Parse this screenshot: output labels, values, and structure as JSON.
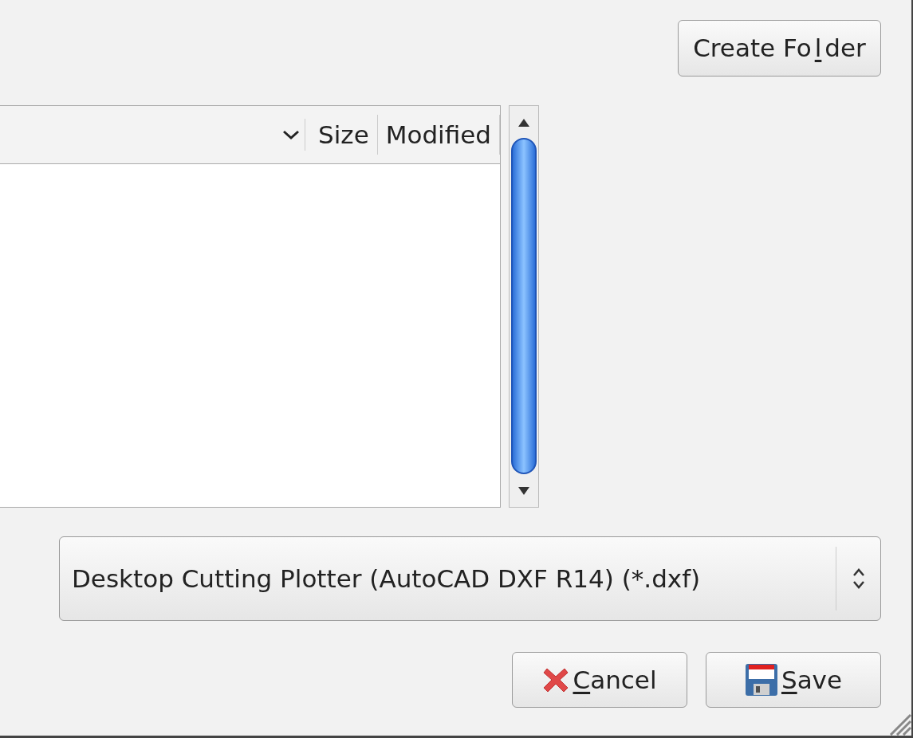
{
  "create_folder_button": {
    "label_before": "Create Fo",
    "access_key": "l",
    "label_after": "der"
  },
  "file_list": {
    "columns": [
      {
        "kind": "sort"
      },
      {
        "kind": "text",
        "label": "Size"
      },
      {
        "kind": "text",
        "label": "Modified"
      }
    ]
  },
  "file_type_filter": {
    "value": "Desktop Cutting Plotter (AutoCAD DXF R14) (*.dxf)"
  },
  "buttons": [
    {
      "kind": "cancel",
      "access_key": "C",
      "label_after": "ancel"
    },
    {
      "kind": "save",
      "access_key": "S",
      "label_after": "ave"
    }
  ]
}
